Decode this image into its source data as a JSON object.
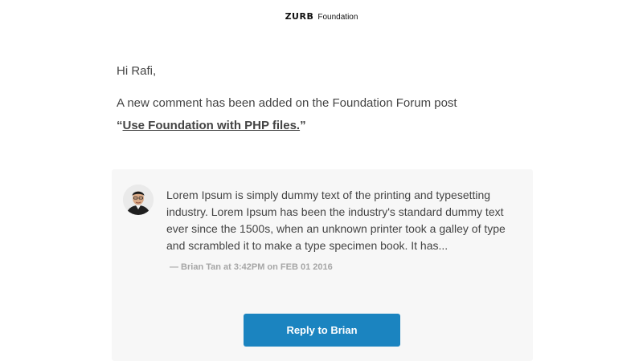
{
  "header": {
    "logo_mark": "ZURB",
    "logo_text": "Foundation"
  },
  "email": {
    "greeting": "Hi Rafi,",
    "intro": "A new comment has been added on the Foundation Forum post",
    "open_quote": "“",
    "post_title": "Use Foundation with PHP files.",
    "close_quote": "”"
  },
  "comment": {
    "avatar_icon": "avatar-icon",
    "text": "Lorem Ipsum is simply dummy text of the printing and typesetting industry. Lorem Ipsum has been the industry's standard dummy text ever since the 1500s, when an unknown printer took a galley of type and scrambled it to make a type specimen book. It has...",
    "meta": "— Brian Tan at 3:42PM on FEB 01 2016",
    "reply_label": "Reply to Brian"
  },
  "colors": {
    "accent": "#1b84c0",
    "card_bg": "#f7f7f7",
    "text": "#444444",
    "meta": "#a6a6a6"
  }
}
